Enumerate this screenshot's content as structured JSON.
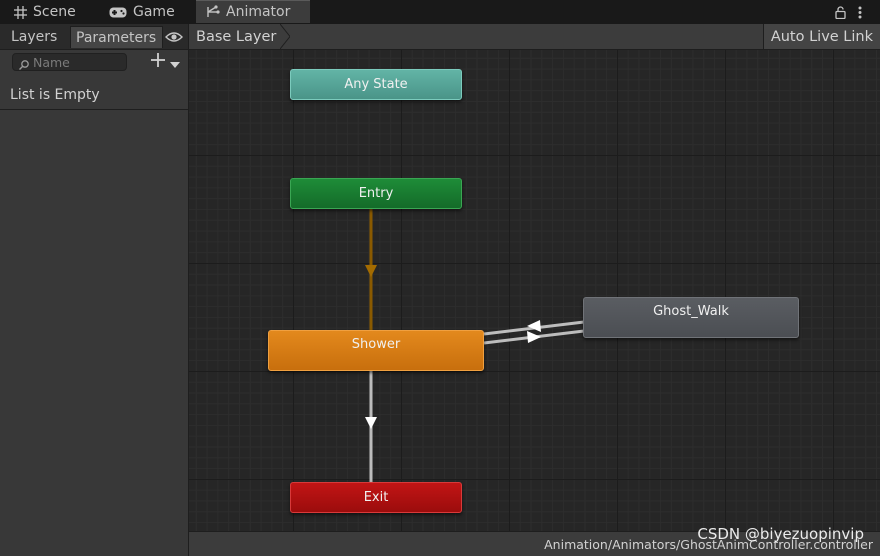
{
  "tabs": {
    "scene": "Scene",
    "game": "Game",
    "animator": "Animator"
  },
  "left_panel": {
    "layers_tab": "Layers",
    "parameters_tab": "Parameters",
    "search_placeholder": "Name",
    "empty_text": "List is Empty"
  },
  "toolbar": {
    "breadcrumb": "Base Layer",
    "auto_live_link": "Auto Live Link"
  },
  "graph": {
    "states": {
      "any_state": "Any State",
      "entry": "Entry",
      "shower": "Shower",
      "ghost_walk": "Ghost_Walk",
      "exit": "Exit"
    }
  },
  "status": {
    "path": "Animation/Animators/GhostAnimController.controller"
  },
  "watermark": "CSDN @biyezuopinvip",
  "colors": {
    "any_state": "#52a093",
    "entry": "#187a30",
    "default_state": "#d97c14",
    "state": "#53565b",
    "exit": "#b21010",
    "default_transition": "#9a6a00",
    "transition": "#c8c8c8"
  }
}
